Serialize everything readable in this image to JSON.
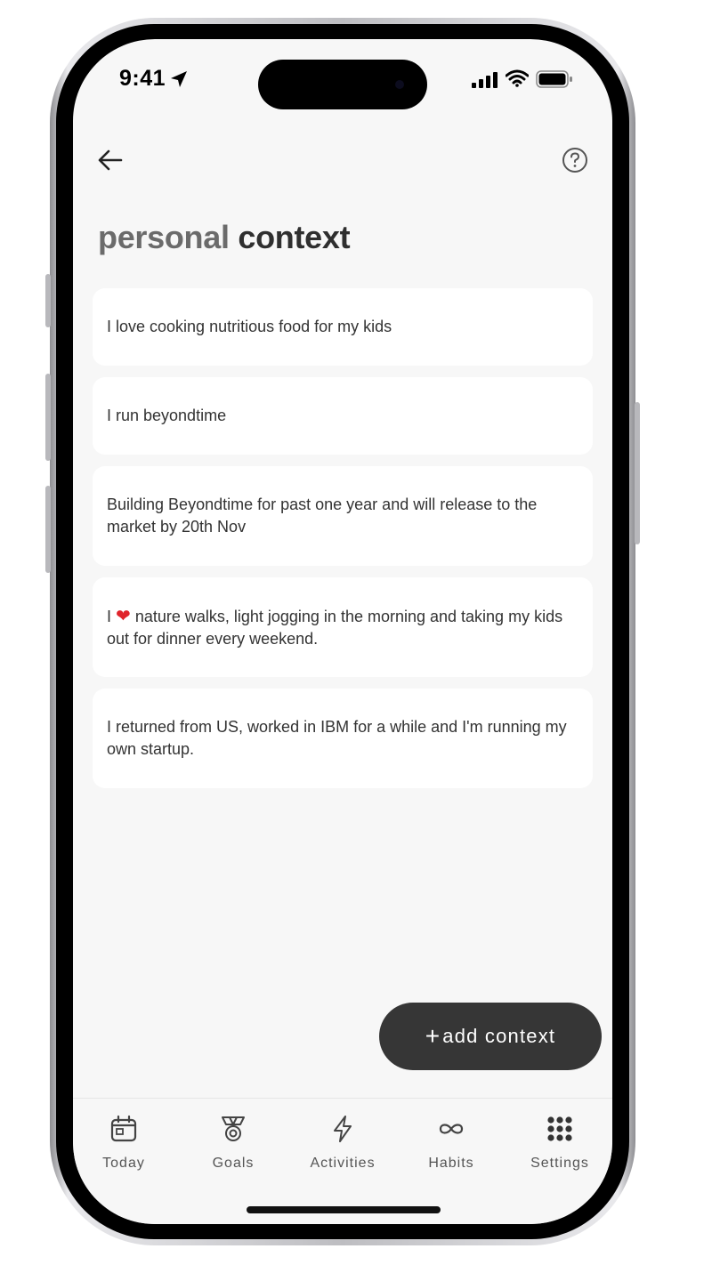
{
  "status_bar": {
    "time": "9:41"
  },
  "title": {
    "part1": "personal",
    "part2": "context"
  },
  "contexts": [
    {
      "text": "I love cooking nutritious food for my kids"
    },
    {
      "text": "I run beyondtime"
    },
    {
      "text": "Building Beyondtime for past one year and will release to the market by 20th Nov"
    },
    {
      "prefix": "I",
      "emoji": "❤",
      "text": "nature walks, light jogging in the morning and taking my kids out for dinner every weekend."
    },
    {
      "text": "I returned from US, worked in IBM for a while and I'm running my own startup."
    }
  ],
  "fab": {
    "plus": "+",
    "label": "add context"
  },
  "tabs": [
    {
      "label": "Today",
      "icon": "calendar-icon"
    },
    {
      "label": "Goals",
      "icon": "medal-icon"
    },
    {
      "label": "Activities",
      "icon": "lightning-icon"
    },
    {
      "label": "Habits",
      "icon": "infinity-icon"
    },
    {
      "label": "Settings",
      "icon": "grid-icon"
    }
  ],
  "colors": {
    "screen_bg": "#f7f7f7",
    "card_bg": "#ffffff",
    "fab_bg": "#363636",
    "heart": "#e0242b"
  }
}
